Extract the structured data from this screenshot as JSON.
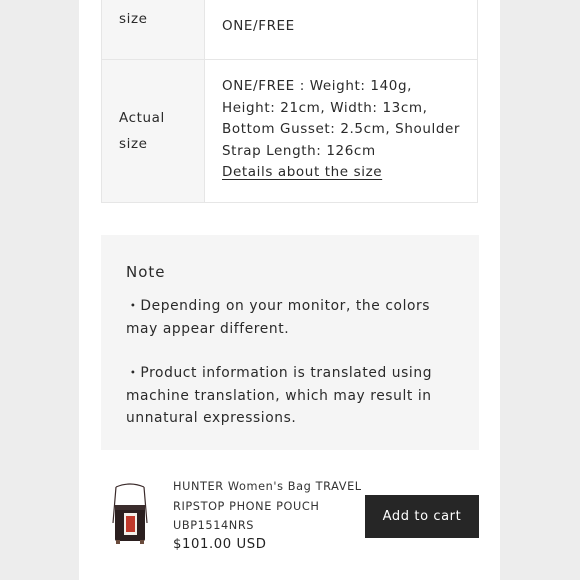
{
  "size_table": {
    "rows": [
      {
        "label": "size",
        "value": "ONE/FREE"
      },
      {
        "label": "Actual size",
        "value": "ONE/FREE : Weight: 140g, Height: 21cm, Width: 13cm, Bottom Gusset: 2.5cm, Shoulder Strap Length: 126cm"
      }
    ],
    "details_link": "Details about the size"
  },
  "note": {
    "title": "Note",
    "items": [
      "・Depending on your monitor, the colors may appear different.",
      "・Product information is translated using machine translation, which may result in unnatural expressions."
    ]
  },
  "product_bar": {
    "title": "HUNTER Women's Bag TRAVEL RIPSTOP PHONE POUCH UBP1514NRS",
    "price": "$101.00 USD",
    "add_to_cart": "Add to cart",
    "thumbnail_icon": "phone-pouch-thumbnail",
    "accent_color": "#262626"
  }
}
